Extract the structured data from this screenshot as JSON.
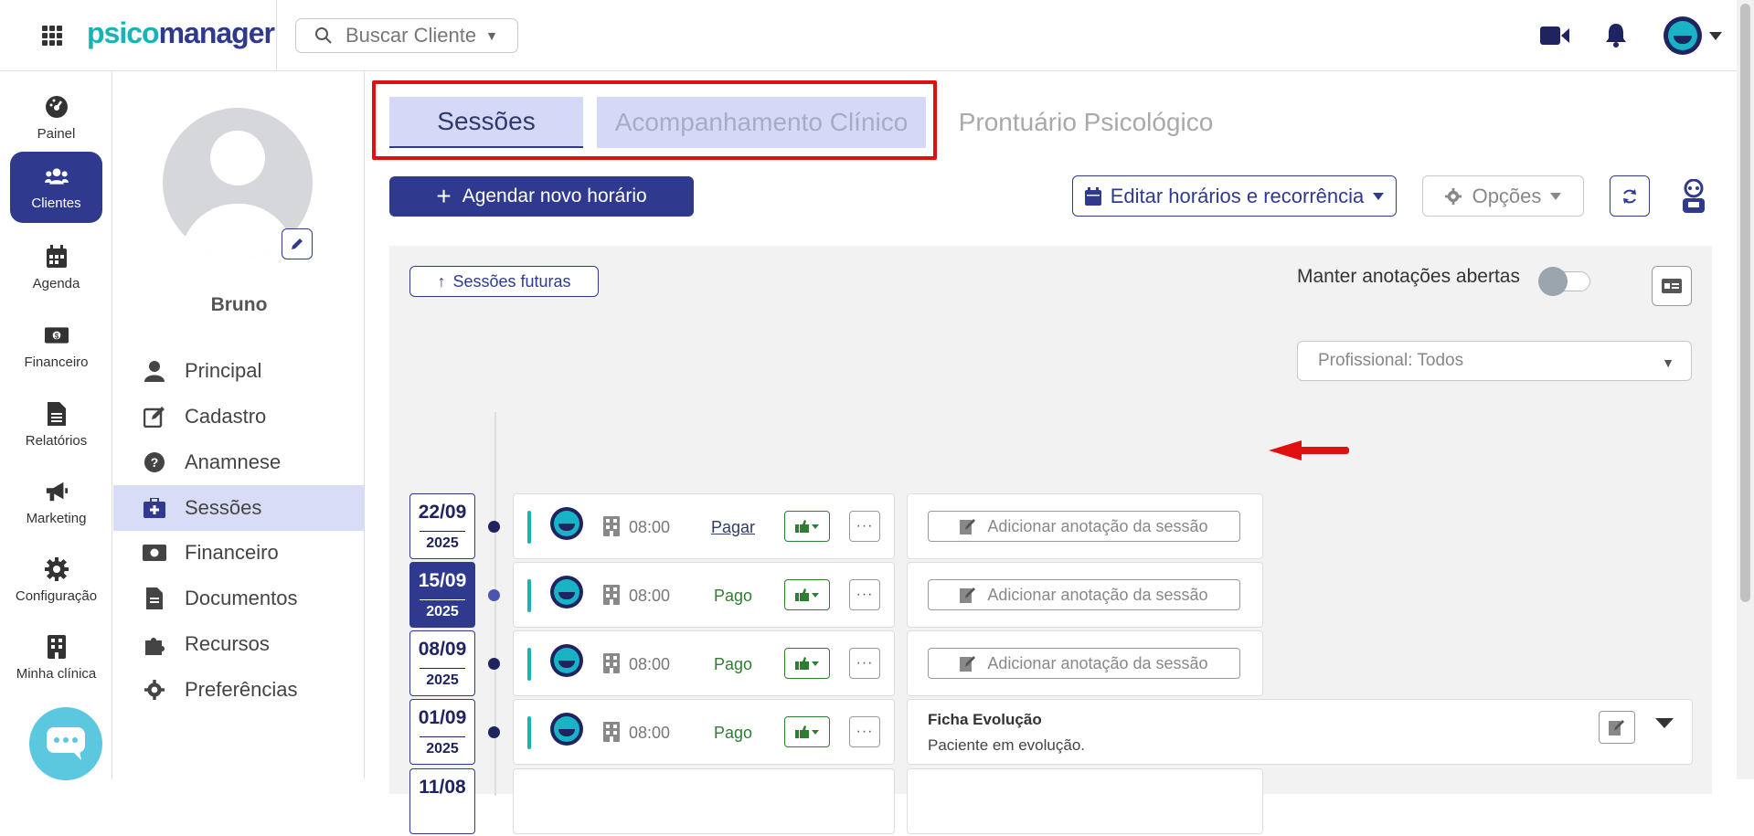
{
  "header": {
    "logo_part1": "psico",
    "logo_part2": "manager",
    "search_placeholder": "Buscar Cliente"
  },
  "nav": {
    "items": [
      {
        "label": "Painel",
        "icon": "dashboard-icon"
      },
      {
        "label": "Clientes",
        "icon": "users-icon"
      },
      {
        "label": "Agenda",
        "icon": "calendar-icon"
      },
      {
        "label": "Financeiro",
        "icon": "money-icon"
      },
      {
        "label": "Relatórios",
        "icon": "file-icon"
      },
      {
        "label": "Marketing",
        "icon": "megaphone-icon"
      },
      {
        "label": "Configuração",
        "icon": "gear-icon"
      },
      {
        "label": "Minha clínica",
        "icon": "building-icon"
      }
    ]
  },
  "client": {
    "name": "Bruno",
    "menu": [
      {
        "label": "Principal",
        "icon": "user-icon"
      },
      {
        "label": "Cadastro",
        "icon": "edit-icon"
      },
      {
        "label": "Anamnese",
        "icon": "question-icon"
      },
      {
        "label": "Sessões",
        "icon": "medkit-icon"
      },
      {
        "label": "Financeiro",
        "icon": "money-icon"
      },
      {
        "label": "Documentos",
        "icon": "file-icon"
      },
      {
        "label": "Recursos",
        "icon": "puzzle-icon"
      },
      {
        "label": "Preferências",
        "icon": "gear-icon"
      }
    ]
  },
  "tabs": [
    "Sessões",
    "Acompanhamento Clínico",
    "Prontuário Psicológico"
  ],
  "toolbar": {
    "new_label": "Agendar novo horário",
    "edit_label": "Editar horários e recorrência",
    "options_label": "Opções"
  },
  "sessions_panel": {
    "future_label": "Sessões futuras",
    "keep_notes_label": "Manter anotações abertas",
    "professional_filter": "Profissional: Todos",
    "rows": [
      {
        "date": "22/09",
        "year": "2025",
        "time": "08:00",
        "payment": "Pagar",
        "note_button": "Adicionar anotação da sessão"
      },
      {
        "date": "15/09",
        "year": "2025",
        "time": "08:00",
        "payment": "Pago",
        "note_button": "Adicionar anotação da sessão"
      },
      {
        "date": "08/09",
        "year": "2025",
        "time": "08:00",
        "payment": "Pago",
        "note_button": "Adicionar anotação da sessão"
      },
      {
        "date": "01/09",
        "year": "2025",
        "time": "08:00",
        "payment": "Pago",
        "note_title": "Ficha Evolução",
        "note_text": "Paciente em evolução."
      },
      {
        "date": "11/08"
      }
    ]
  },
  "colors": {
    "primary": "#2f3a8f",
    "accent": "#19b3b7",
    "tab_bg": "#d5d9f7",
    "highlight_frame": "#e01010",
    "paid_green": "#2e7d32"
  }
}
